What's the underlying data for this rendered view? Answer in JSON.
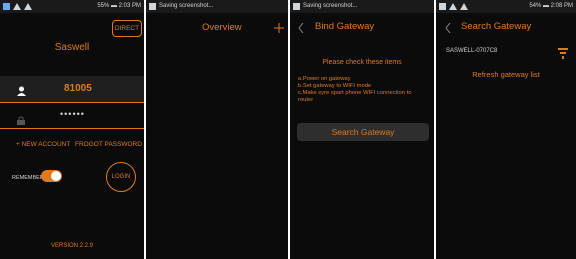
{
  "screens": {
    "login": {
      "statusbar": {
        "right": "55% ▬ 2:03 PM"
      },
      "direct_button": "DIRECT",
      "app_title": "Saswell",
      "user_field": {
        "value": "81005"
      },
      "password_field": {
        "value": "••••••"
      },
      "new_account": "+ NEW ACCOUNT",
      "forgot_password": "FROGOT PASSWORD",
      "remember_label": "REMEMBER",
      "remember_on": true,
      "login_button": "LOGIN",
      "version": "VERSION 2.2.9"
    },
    "overview": {
      "statusbar": {
        "left": "Saving screenshot..."
      },
      "title": "Overview",
      "add_icon": "plus-icon"
    },
    "bind_gateway": {
      "statusbar": {
        "left": "Saving screenshot..."
      },
      "title": "Bind Gateway",
      "check_title": "Please check these items",
      "items": [
        "a.Power on gateway",
        "b.Set gateway to WIFI mode",
        "c.Make syre spart phone WIFI connection to router"
      ],
      "search_button": "Search Gateway"
    },
    "search_gateway": {
      "statusbar": {
        "right": "54% ▬ 2:08 PM"
      },
      "title": "Search Gateway",
      "gateway_id": "SASWELL-0707C8",
      "refresh": "Refresh gateway list"
    }
  },
  "colors": {
    "accent": "#e07a1f",
    "panel_bg": "#0b0b0b",
    "statusbar_bg": "#1a1a1a"
  }
}
